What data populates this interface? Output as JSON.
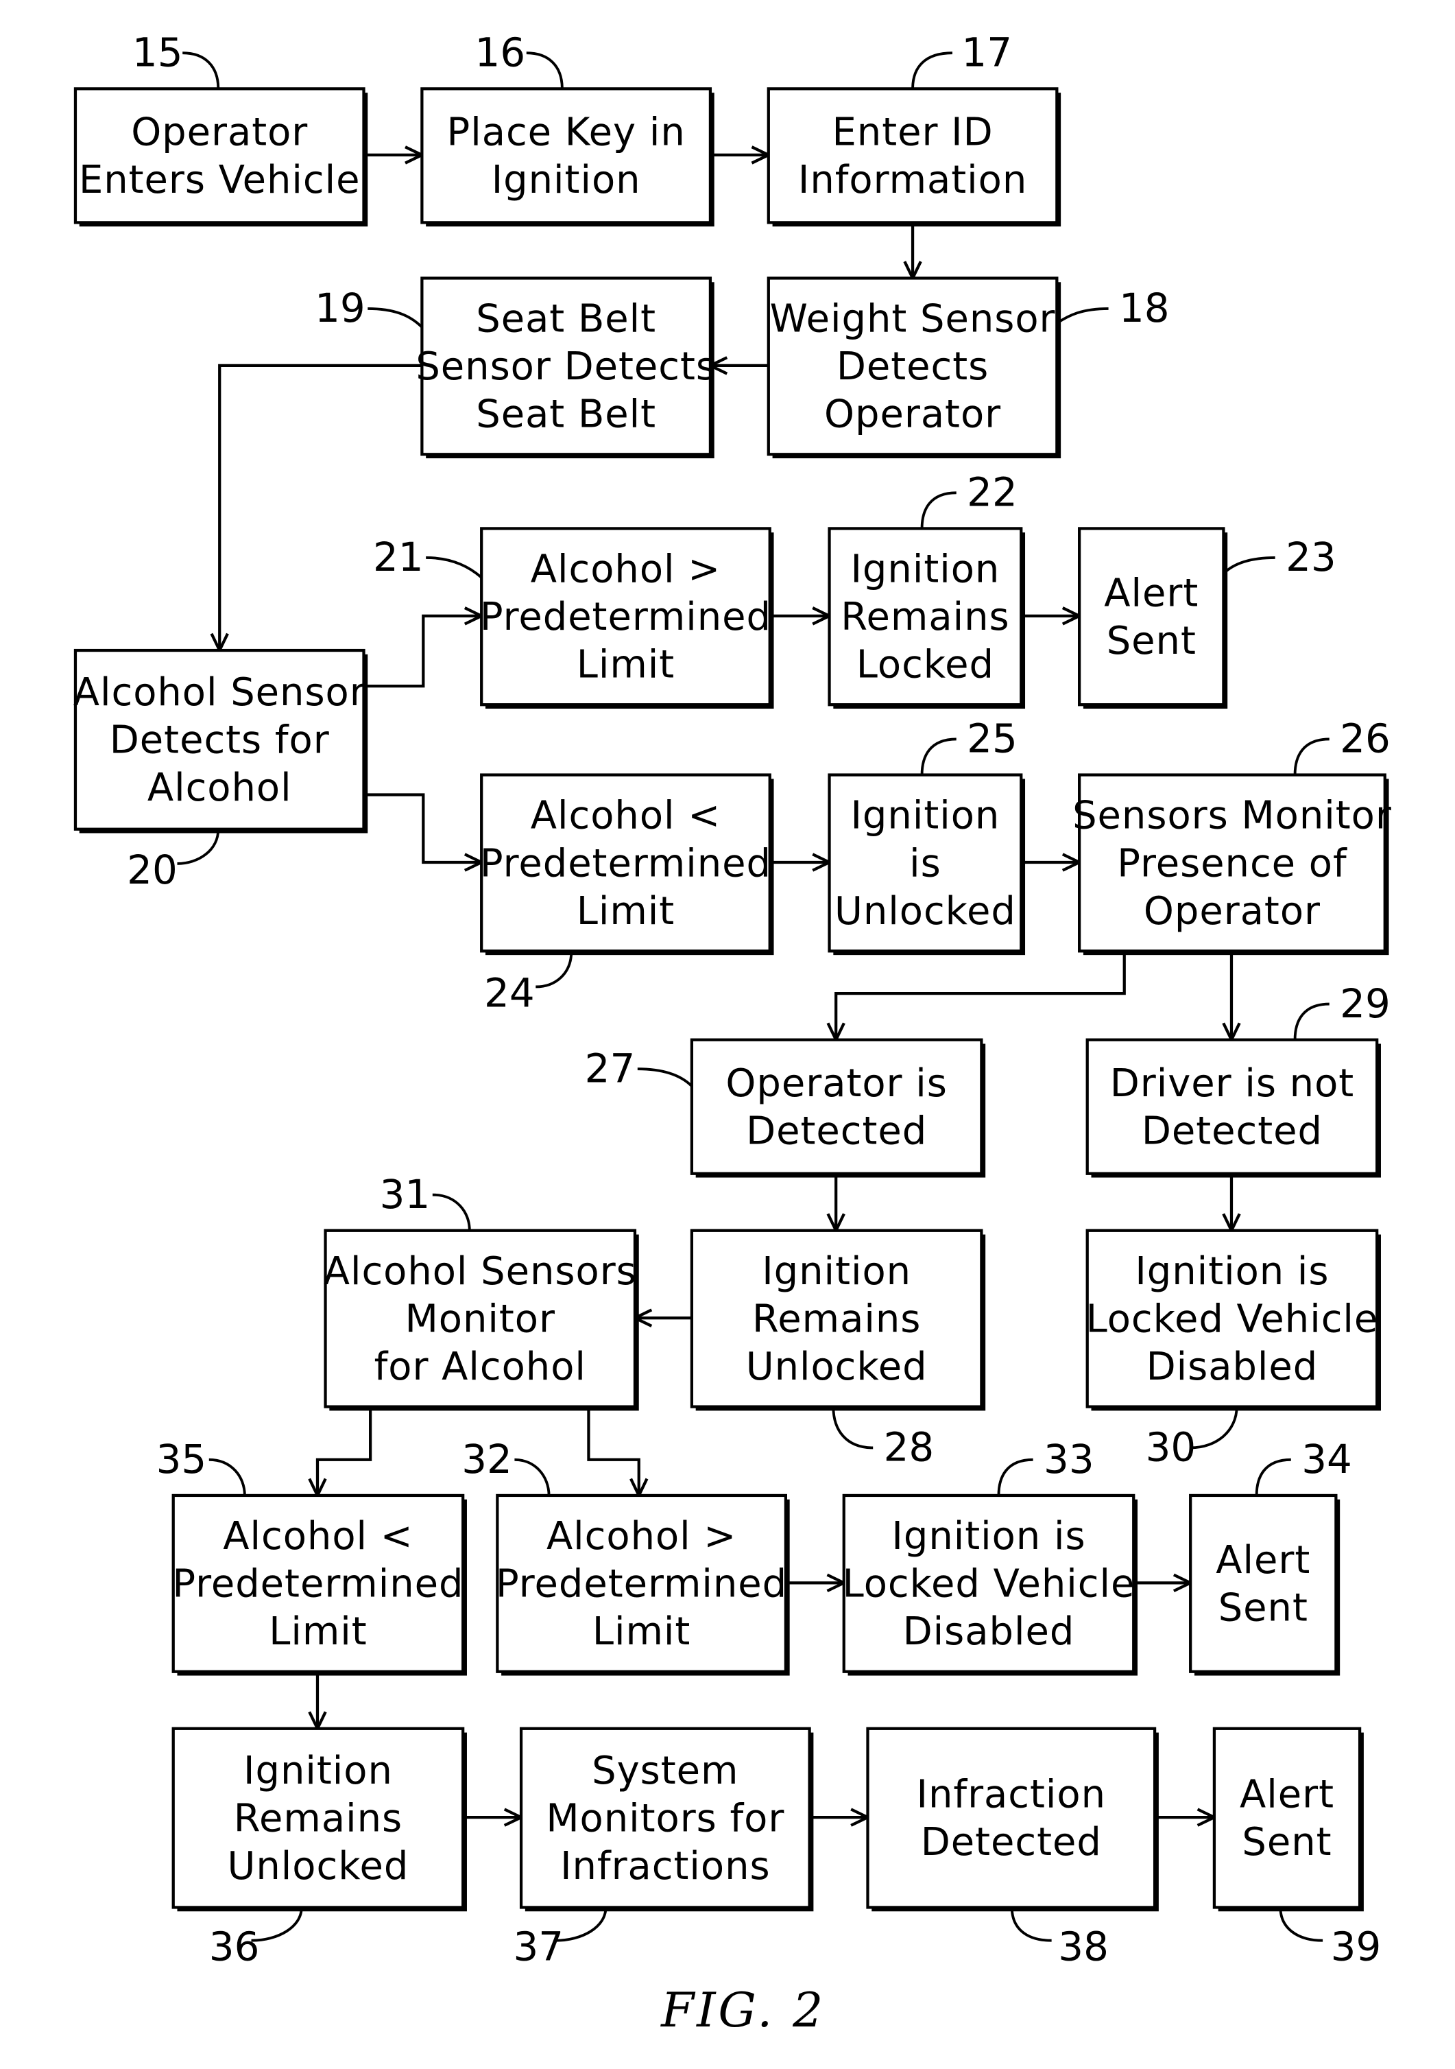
{
  "figure": {
    "caption": "FIG. 2",
    "boxes": [
      {
        "id": "15",
        "lines": [
          "Operator",
          "Enters Vehicle"
        ]
      },
      {
        "id": "16",
        "lines": [
          "Place Key in",
          "Ignition"
        ]
      },
      {
        "id": "17",
        "lines": [
          "Enter ID",
          "Information"
        ]
      },
      {
        "id": "18",
        "lines": [
          "Weight Sensor",
          "Detects",
          "Operator"
        ]
      },
      {
        "id": "19",
        "lines": [
          "Seat Belt",
          "Sensor Detects",
          "Seat Belt"
        ]
      },
      {
        "id": "20",
        "lines": [
          "Alcohol Sensor",
          "Detects for",
          "Alcohol"
        ]
      },
      {
        "id": "21",
        "lines": [
          "Alcohol >",
          "Predetermined",
          "Limit"
        ]
      },
      {
        "id": "22",
        "lines": [
          "Ignition",
          "Remains",
          "Locked"
        ]
      },
      {
        "id": "23",
        "lines": [
          "Alert",
          "Sent"
        ]
      },
      {
        "id": "24",
        "lines": [
          "Alcohol <",
          "Predetermined",
          "Limit"
        ]
      },
      {
        "id": "25",
        "lines": [
          "Ignition",
          "is",
          "Unlocked"
        ]
      },
      {
        "id": "26",
        "lines": [
          "Sensors Monitor",
          "Presence of",
          "Operator"
        ]
      },
      {
        "id": "27",
        "lines": [
          "Operator is",
          "Detected"
        ]
      },
      {
        "id": "28",
        "lines": [
          "Ignition",
          "Remains",
          "Unlocked"
        ]
      },
      {
        "id": "29",
        "lines": [
          "Driver is not",
          "Detected"
        ]
      },
      {
        "id": "30",
        "lines": [
          "Ignition is",
          "Locked Vehicle",
          "Disabled"
        ]
      },
      {
        "id": "31",
        "lines": [
          "Alcohol Sensors",
          "Monitor",
          "for Alcohol"
        ]
      },
      {
        "id": "32",
        "lines": [
          "Alcohol >",
          "Predetermined",
          "Limit"
        ]
      },
      {
        "id": "33",
        "lines": [
          "Ignition is",
          "Locked Vehicle",
          "Disabled"
        ]
      },
      {
        "id": "34",
        "lines": [
          "Alert",
          "Sent"
        ]
      },
      {
        "id": "35",
        "lines": [
          "Alcohol <",
          "Predetermined",
          "Limit"
        ]
      },
      {
        "id": "36",
        "lines": [
          "Ignition",
          "Remains",
          "Unlocked"
        ]
      },
      {
        "id": "37",
        "lines": [
          "System",
          "Monitors for",
          "Infractions"
        ]
      },
      {
        "id": "38",
        "lines": [
          "Infraction",
          "Detected"
        ]
      },
      {
        "id": "39",
        "lines": [
          "Alert",
          "Sent"
        ]
      }
    ],
    "connections": [
      {
        "from": "15",
        "to": "16"
      },
      {
        "from": "16",
        "to": "17"
      },
      {
        "from": "17",
        "to": "18"
      },
      {
        "from": "18",
        "to": "19"
      },
      {
        "from": "19",
        "to": "20"
      },
      {
        "from": "20",
        "to": "21"
      },
      {
        "from": "20",
        "to": "24"
      },
      {
        "from": "21",
        "to": "22"
      },
      {
        "from": "22",
        "to": "23"
      },
      {
        "from": "24",
        "to": "25"
      },
      {
        "from": "25",
        "to": "26"
      },
      {
        "from": "26",
        "to": "27"
      },
      {
        "from": "26",
        "to": "29"
      },
      {
        "from": "27",
        "to": "28"
      },
      {
        "from": "29",
        "to": "30"
      },
      {
        "from": "28",
        "to": "31"
      },
      {
        "from": "31",
        "to": "35"
      },
      {
        "from": "31",
        "to": "32"
      },
      {
        "from": "32",
        "to": "33"
      },
      {
        "from": "33",
        "to": "34"
      },
      {
        "from": "35",
        "to": "36"
      },
      {
        "from": "36",
        "to": "37"
      },
      {
        "from": "37",
        "to": "38"
      },
      {
        "from": "38",
        "to": "39"
      }
    ]
  }
}
